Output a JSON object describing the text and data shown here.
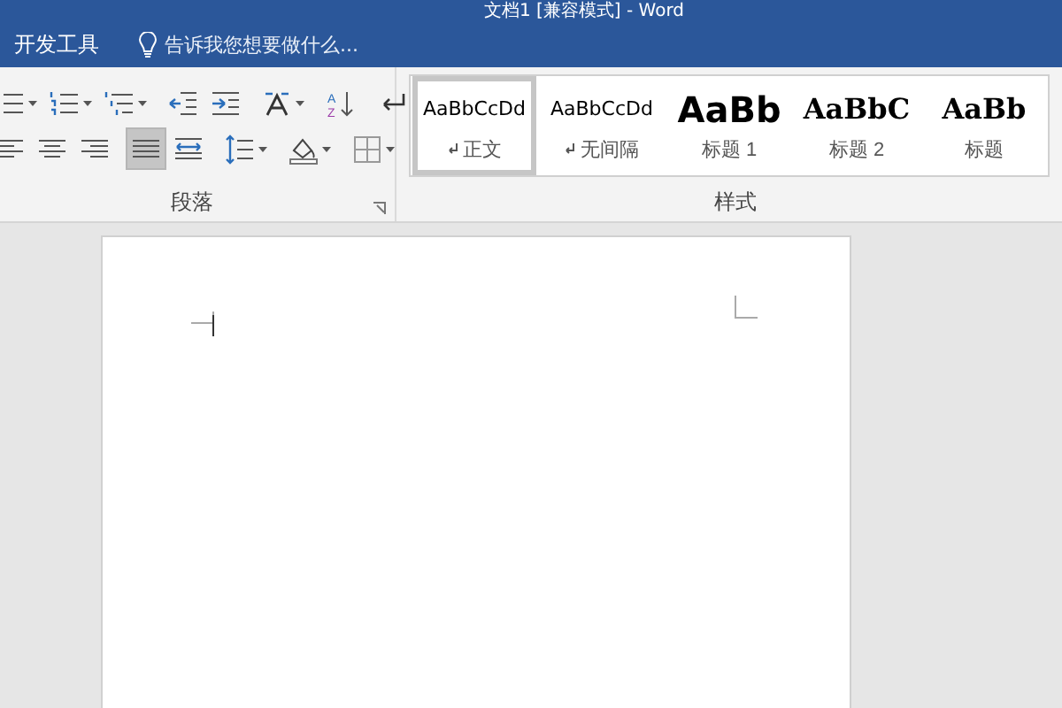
{
  "window": {
    "title": "文档1 [兼容模式] - Word"
  },
  "tabs": [
    {
      "label": "开发工具",
      "selected": false
    }
  ],
  "tell_me": {
    "placeholder": "告诉我您想要做什么..."
  },
  "paragraph_group": {
    "label": "段落",
    "row_1": [
      {
        "kind": "bullets",
        "dropdown": true
      },
      {
        "kind": "numbering",
        "dropdown": true
      },
      {
        "kind": "multilevel",
        "dropdown": true
      },
      {
        "kind": "outdent",
        "dropdown": false
      },
      {
        "kind": "indent",
        "dropdown": false
      },
      {
        "kind": "asian-layout",
        "dropdown": true
      },
      {
        "kind": "sort",
        "dropdown": false,
        "letters": [
          "A",
          "Z"
        ]
      },
      {
        "kind": "marks",
        "dropdown": false
      }
    ],
    "row_2": [
      {
        "kind": "align-left",
        "dropdown": false,
        "selected": false
      },
      {
        "kind": "align-center",
        "dropdown": false,
        "selected": false
      },
      {
        "kind": "align-right",
        "dropdown": false,
        "selected": false
      },
      {
        "kind": "justify",
        "dropdown": false,
        "selected": true
      },
      {
        "kind": "distribute",
        "dropdown": false,
        "selected": false
      },
      {
        "kind": "line-spacing",
        "dropdown": true,
        "selected": false
      },
      {
        "kind": "shading",
        "dropdown": true,
        "selected": false
      },
      {
        "kind": "borders",
        "dropdown": true,
        "selected": false
      }
    ]
  },
  "styles_group": {
    "label": "样式",
    "styles": [
      {
        "kind": "normal",
        "preview": "AaBbCcDd",
        "name": "正文",
        "selected": true
      },
      {
        "kind": "normal",
        "preview": "AaBbCcDd",
        "name": "无间隔",
        "selected": false
      },
      {
        "kind": "heading1",
        "preview": "AaBb",
        "name": "标题 1",
        "selected": false
      },
      {
        "kind": "heading2",
        "preview": "AaBbC",
        "name": "标题 2",
        "selected": false
      },
      {
        "kind": "title",
        "preview": "AaBb",
        "name": "标题",
        "selected": false
      }
    ]
  }
}
